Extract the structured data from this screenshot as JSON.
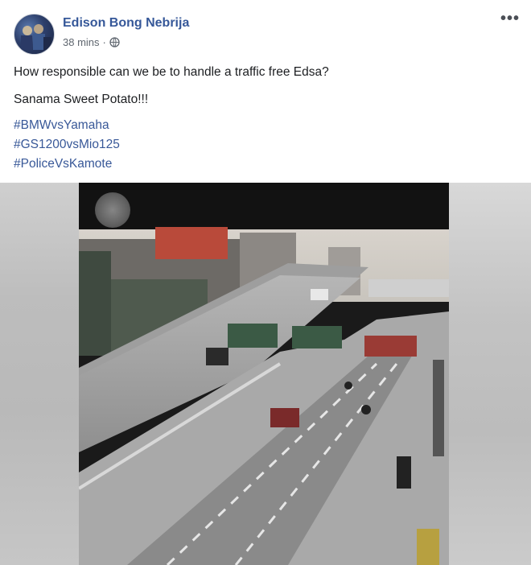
{
  "post": {
    "author": "Edison Bong Nebrija",
    "time": "38 mins",
    "separator": "·",
    "privacy_icon": "globe-icon",
    "more_icon": "more-options-icon",
    "more_glyph": "•••",
    "lines": [
      "How responsible can we be to handle a traffic free Edsa?",
      "Sanama Sweet Potato!!!"
    ],
    "hashtags": [
      "#BMWvsYamaha",
      "#GS1200vsMio125",
      "#PoliceVsKamote"
    ]
  },
  "colors": {
    "author_link": "#365899",
    "hashtag": "#385898",
    "meta_text": "#606770",
    "body_text": "#1c1e21"
  },
  "media": {
    "type": "video",
    "control_icon": "play-icon"
  }
}
